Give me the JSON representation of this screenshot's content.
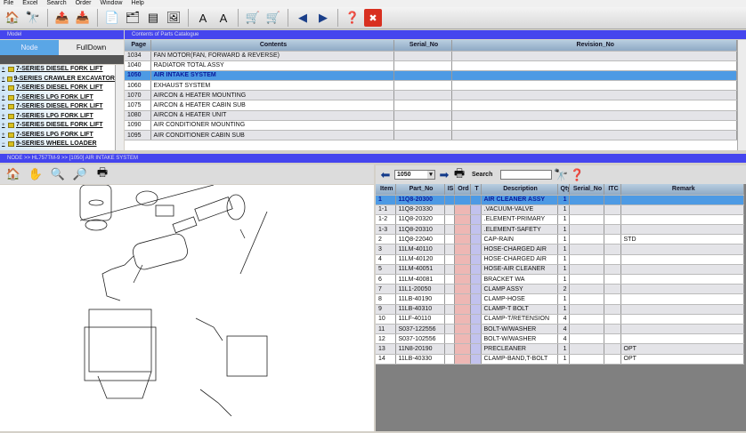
{
  "menu": [
    "File",
    "Excel",
    "Search",
    "Order",
    "Window",
    "Help"
  ],
  "toolbar_icons": [
    "home-icon",
    "binoculars-icon",
    "export-icon",
    "import-icon",
    "list-icon",
    "image-list-icon",
    "split-view-icon",
    "picture-icon",
    "font-increase-icon",
    "font-decrease-icon",
    "cart-add-icon",
    "cart-remove-icon",
    "back-arrow-icon",
    "forward-arrow-icon",
    "help-icon",
    "close-icon"
  ],
  "model_panel": {
    "title": "Model",
    "tabs": [
      "Node",
      "FullDown"
    ],
    "items": [
      "7-SERIES DIESEL FORK LIFT",
      "9-SERIES CRAWLER EXCAVATOR",
      "7-SERIES DIESEL FORK LIFT",
      "7-SERIES LPG FORK LIFT",
      "7-SERIES DIESEL FORK LIFT",
      "7-SERIES LPG FORK LIFT",
      "7-SERIES DIESEL FORK LIFT",
      "7-SERIES LPG FORK LIFT",
      "9-SERIES WHEEL LOADER"
    ]
  },
  "contents": {
    "title": "Contents of Parts Catalogue",
    "headers": [
      "Page",
      "Contents",
      "Serial_No",
      "Revision_No"
    ],
    "rows": [
      [
        "1034",
        "FAN MOTOR(FAN, FORWARD & REVERSE)"
      ],
      [
        "1040",
        "RADIATOR TOTAL ASSY"
      ],
      [
        "1050",
        "AIR INTAKE SYSTEM"
      ],
      [
        "1060",
        "EXHAUST SYSTEM"
      ],
      [
        "1070",
        "AIRCON & HEATER MOUNTING"
      ],
      [
        "1075",
        "AIRCON & HEATER CABIN SUB"
      ],
      [
        "1080",
        "AIRCON & HEATER UNIT"
      ],
      [
        "1090",
        "AIR CONDITIONER MOUNTING"
      ],
      [
        "1095",
        "AIR CONDITIONER CABIN SUB"
      ]
    ],
    "selected_index": 2
  },
  "breadcrumb": "NODE >> HL757TM-9 >> [1050] AIR INTAKE SYSTEM",
  "parts": {
    "page_value": "1050",
    "search_label": "Search",
    "search_value": "",
    "headers": [
      "Item",
      "Part_No",
      "IS",
      "Ord",
      "T",
      "Description",
      "Qty",
      "Serial_No",
      "ITC",
      "Remark"
    ],
    "rows": [
      [
        "1",
        "11Q8-20300",
        "AIR CLEANER ASSY",
        "1",
        ""
      ],
      [
        "1-1",
        "11Q8-20330",
        ".VACUUM-VALVE",
        "1",
        ""
      ],
      [
        "1-2",
        "11Q8-20320",
        ".ELEMENT-PRIMARY",
        "1",
        ""
      ],
      [
        "1-3",
        "11Q8-20310",
        ".ELEMENT-SAFETY",
        "1",
        ""
      ],
      [
        "2",
        "11Q8-22040",
        "CAP-RAIN",
        "1",
        "STD"
      ],
      [
        "3",
        "11LM-40110",
        "HOSE-CHARGED AIR",
        "1",
        ""
      ],
      [
        "4",
        "11LM-40120",
        "HOSE-CHARGED AIR",
        "1",
        ""
      ],
      [
        "5",
        "11LM-40051",
        "HOSE-AIR CLEANER",
        "1",
        ""
      ],
      [
        "6",
        "11LM-40081",
        "BRACKET WA",
        "1",
        ""
      ],
      [
        "7",
        "11L1-20050",
        "CLAMP ASSY",
        "2",
        ""
      ],
      [
        "8",
        "11LB-40190",
        "CLAMP-HOSE",
        "1",
        ""
      ],
      [
        "9",
        "11LB-40310",
        "CLAMP-T BOLT",
        "1",
        ""
      ],
      [
        "10",
        "11LF-40110",
        "CLAMP-T/RETENSION",
        "4",
        ""
      ],
      [
        "11",
        "S037-122556",
        "BOLT-W/WASHER",
        "4",
        ""
      ],
      [
        "12",
        "S037-102556",
        "BOLT-W/WASHER",
        "4",
        ""
      ],
      [
        "13",
        "11N8-20190",
        "PRECLEANER",
        "1",
        "OPT"
      ],
      [
        "14",
        "11LB-40330",
        "CLAMP-BAND,T-BOLT",
        "1",
        "OPT"
      ]
    ],
    "selected_index": 0
  },
  "colors": {
    "title_bar": "#4545ee",
    "selection": "#4d9ae4",
    "ord_column": "#eeb7b4",
    "t_column": "#c2c2ee"
  }
}
